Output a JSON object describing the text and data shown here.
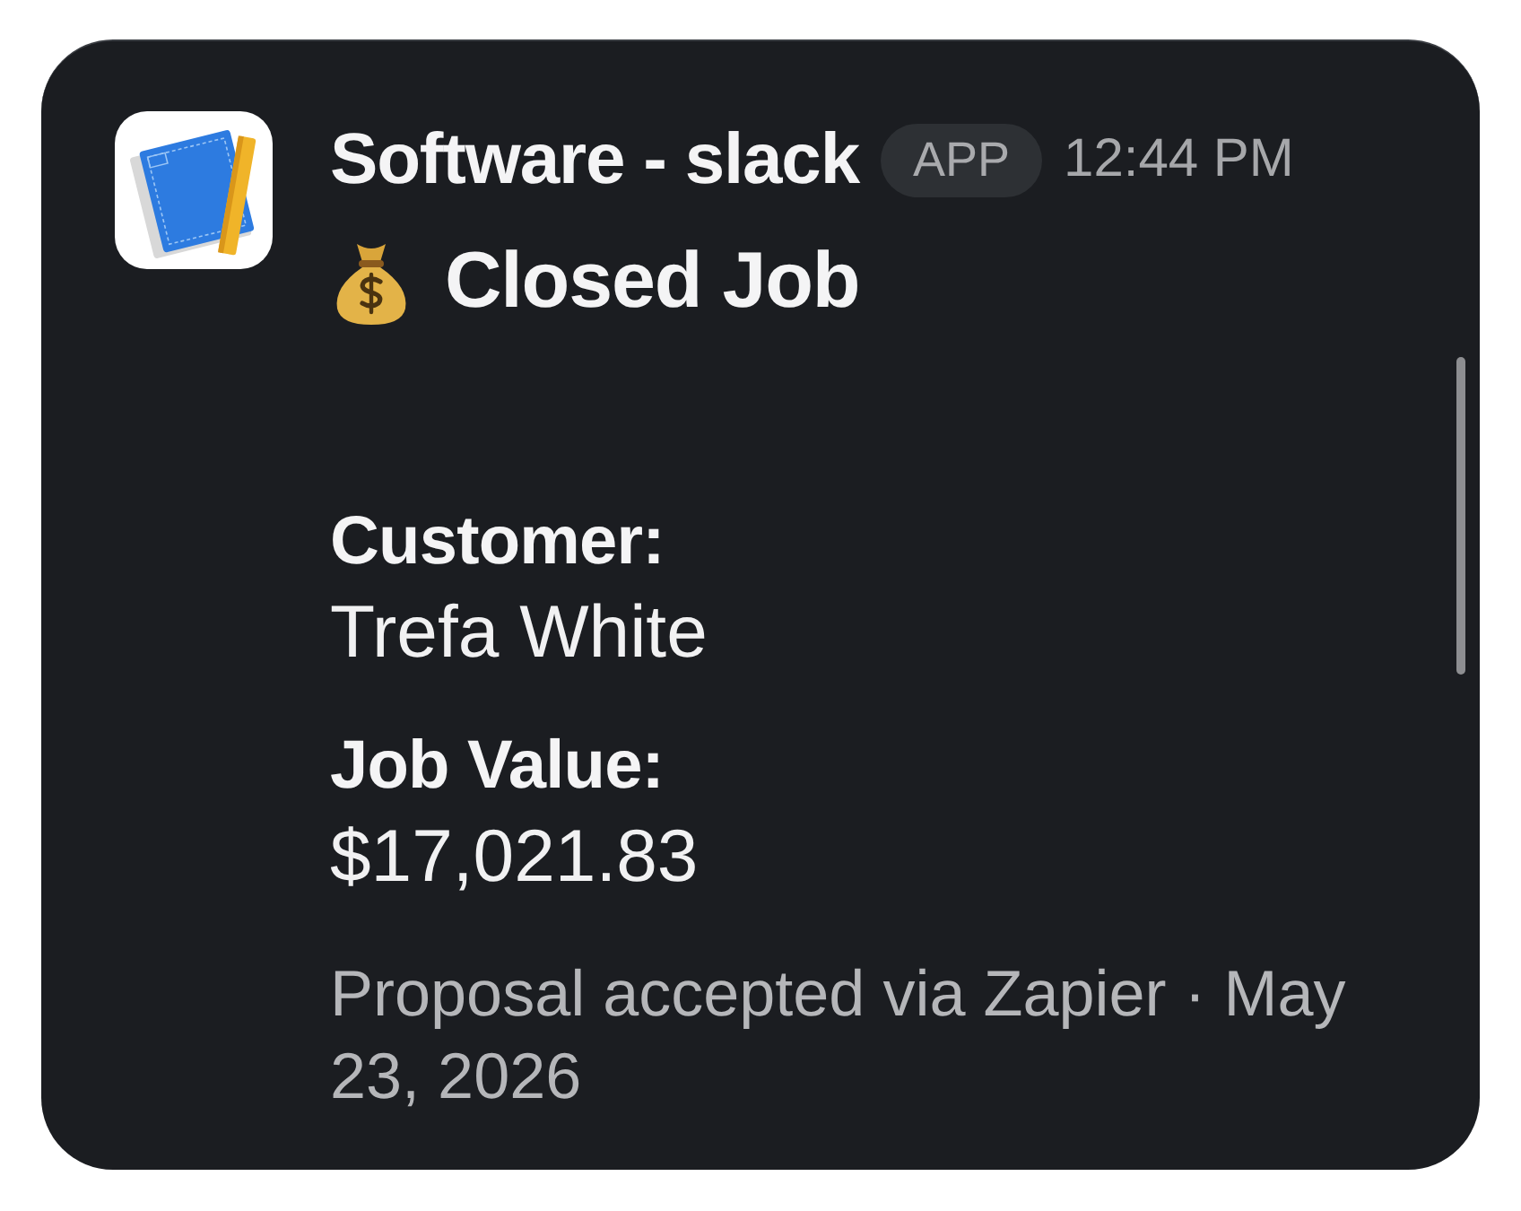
{
  "message": {
    "sender": "Software - slack",
    "badge": "APP",
    "time": "12:44 PM",
    "title": "Closed Job",
    "fields": [
      {
        "label": "Customer:",
        "value": "Trefa White"
      },
      {
        "label": "Job Value:",
        "value": "$17,021.83"
      }
    ],
    "footer": "Proposal accepted via Zapier · May 23, 2026"
  }
}
